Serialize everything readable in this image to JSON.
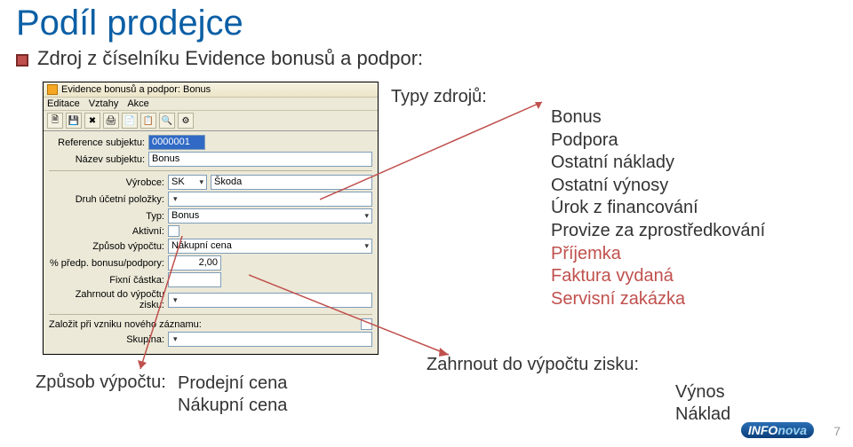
{
  "slide": {
    "title": "Podíl prodejce",
    "bullet": "Zdroj z číselníku Evidence bonusů a podpor:",
    "page_number": "7"
  },
  "window": {
    "title": "Evidence bonusů a podpor: Bonus",
    "menu": {
      "edit": "Editace",
      "vztahy": "Vztahy",
      "akce": "Akce"
    },
    "labels": {
      "reference": "Reference subjektu:",
      "nazev": "Název subjektu:",
      "vyrobce": "Výrobce:",
      "druh": "Druh účetní položky:",
      "typ": "Typ:",
      "aktivni": "Aktivní:",
      "zpusob": "Způsob výpočtu:",
      "predp": "% předp. bonusu/podpory:",
      "fixni": "Fixní částka:",
      "zahrnout": "Zahrnout do výpočtu zisku:",
      "zalozit": "Založit při vzniku nového záznamu:",
      "skupina": "Skupina:"
    },
    "values": {
      "reference": "0000001",
      "nazev": "Bonus",
      "vyrobce_code": "SK",
      "vyrobce_name": "Škoda",
      "typ": "Bonus",
      "zpusob": "Nákupní cena",
      "predp": "2,00"
    }
  },
  "right": {
    "heading": "Typy zdrojů:",
    "items": [
      {
        "label": "Bonus",
        "red": false
      },
      {
        "label": "Podpora",
        "red": false
      },
      {
        "label": "Ostatní náklady",
        "red": false
      },
      {
        "label": "Ostatní výnosy",
        "red": false
      },
      {
        "label": "Úrok z financování",
        "red": false
      },
      {
        "label": "Provize za zprostředkování",
        "red": false
      },
      {
        "label": "Příjemka",
        "red": true
      },
      {
        "label": "Faktura vydaná",
        "red": true
      },
      {
        "label": "Servisní zakázka",
        "red": true
      }
    ]
  },
  "bottom": {
    "zpusob_label": "Způsob výpočtu:",
    "zpusob_opts": [
      "Prodejní cena",
      "Nákupní cena"
    ],
    "zahrnout_label": "Zahrnout do výpočtu zisku:",
    "zahrnout_opts": [
      "Výnos",
      "Náklad"
    ]
  },
  "logo": {
    "part1": "INFO",
    "part2": "nova"
  }
}
